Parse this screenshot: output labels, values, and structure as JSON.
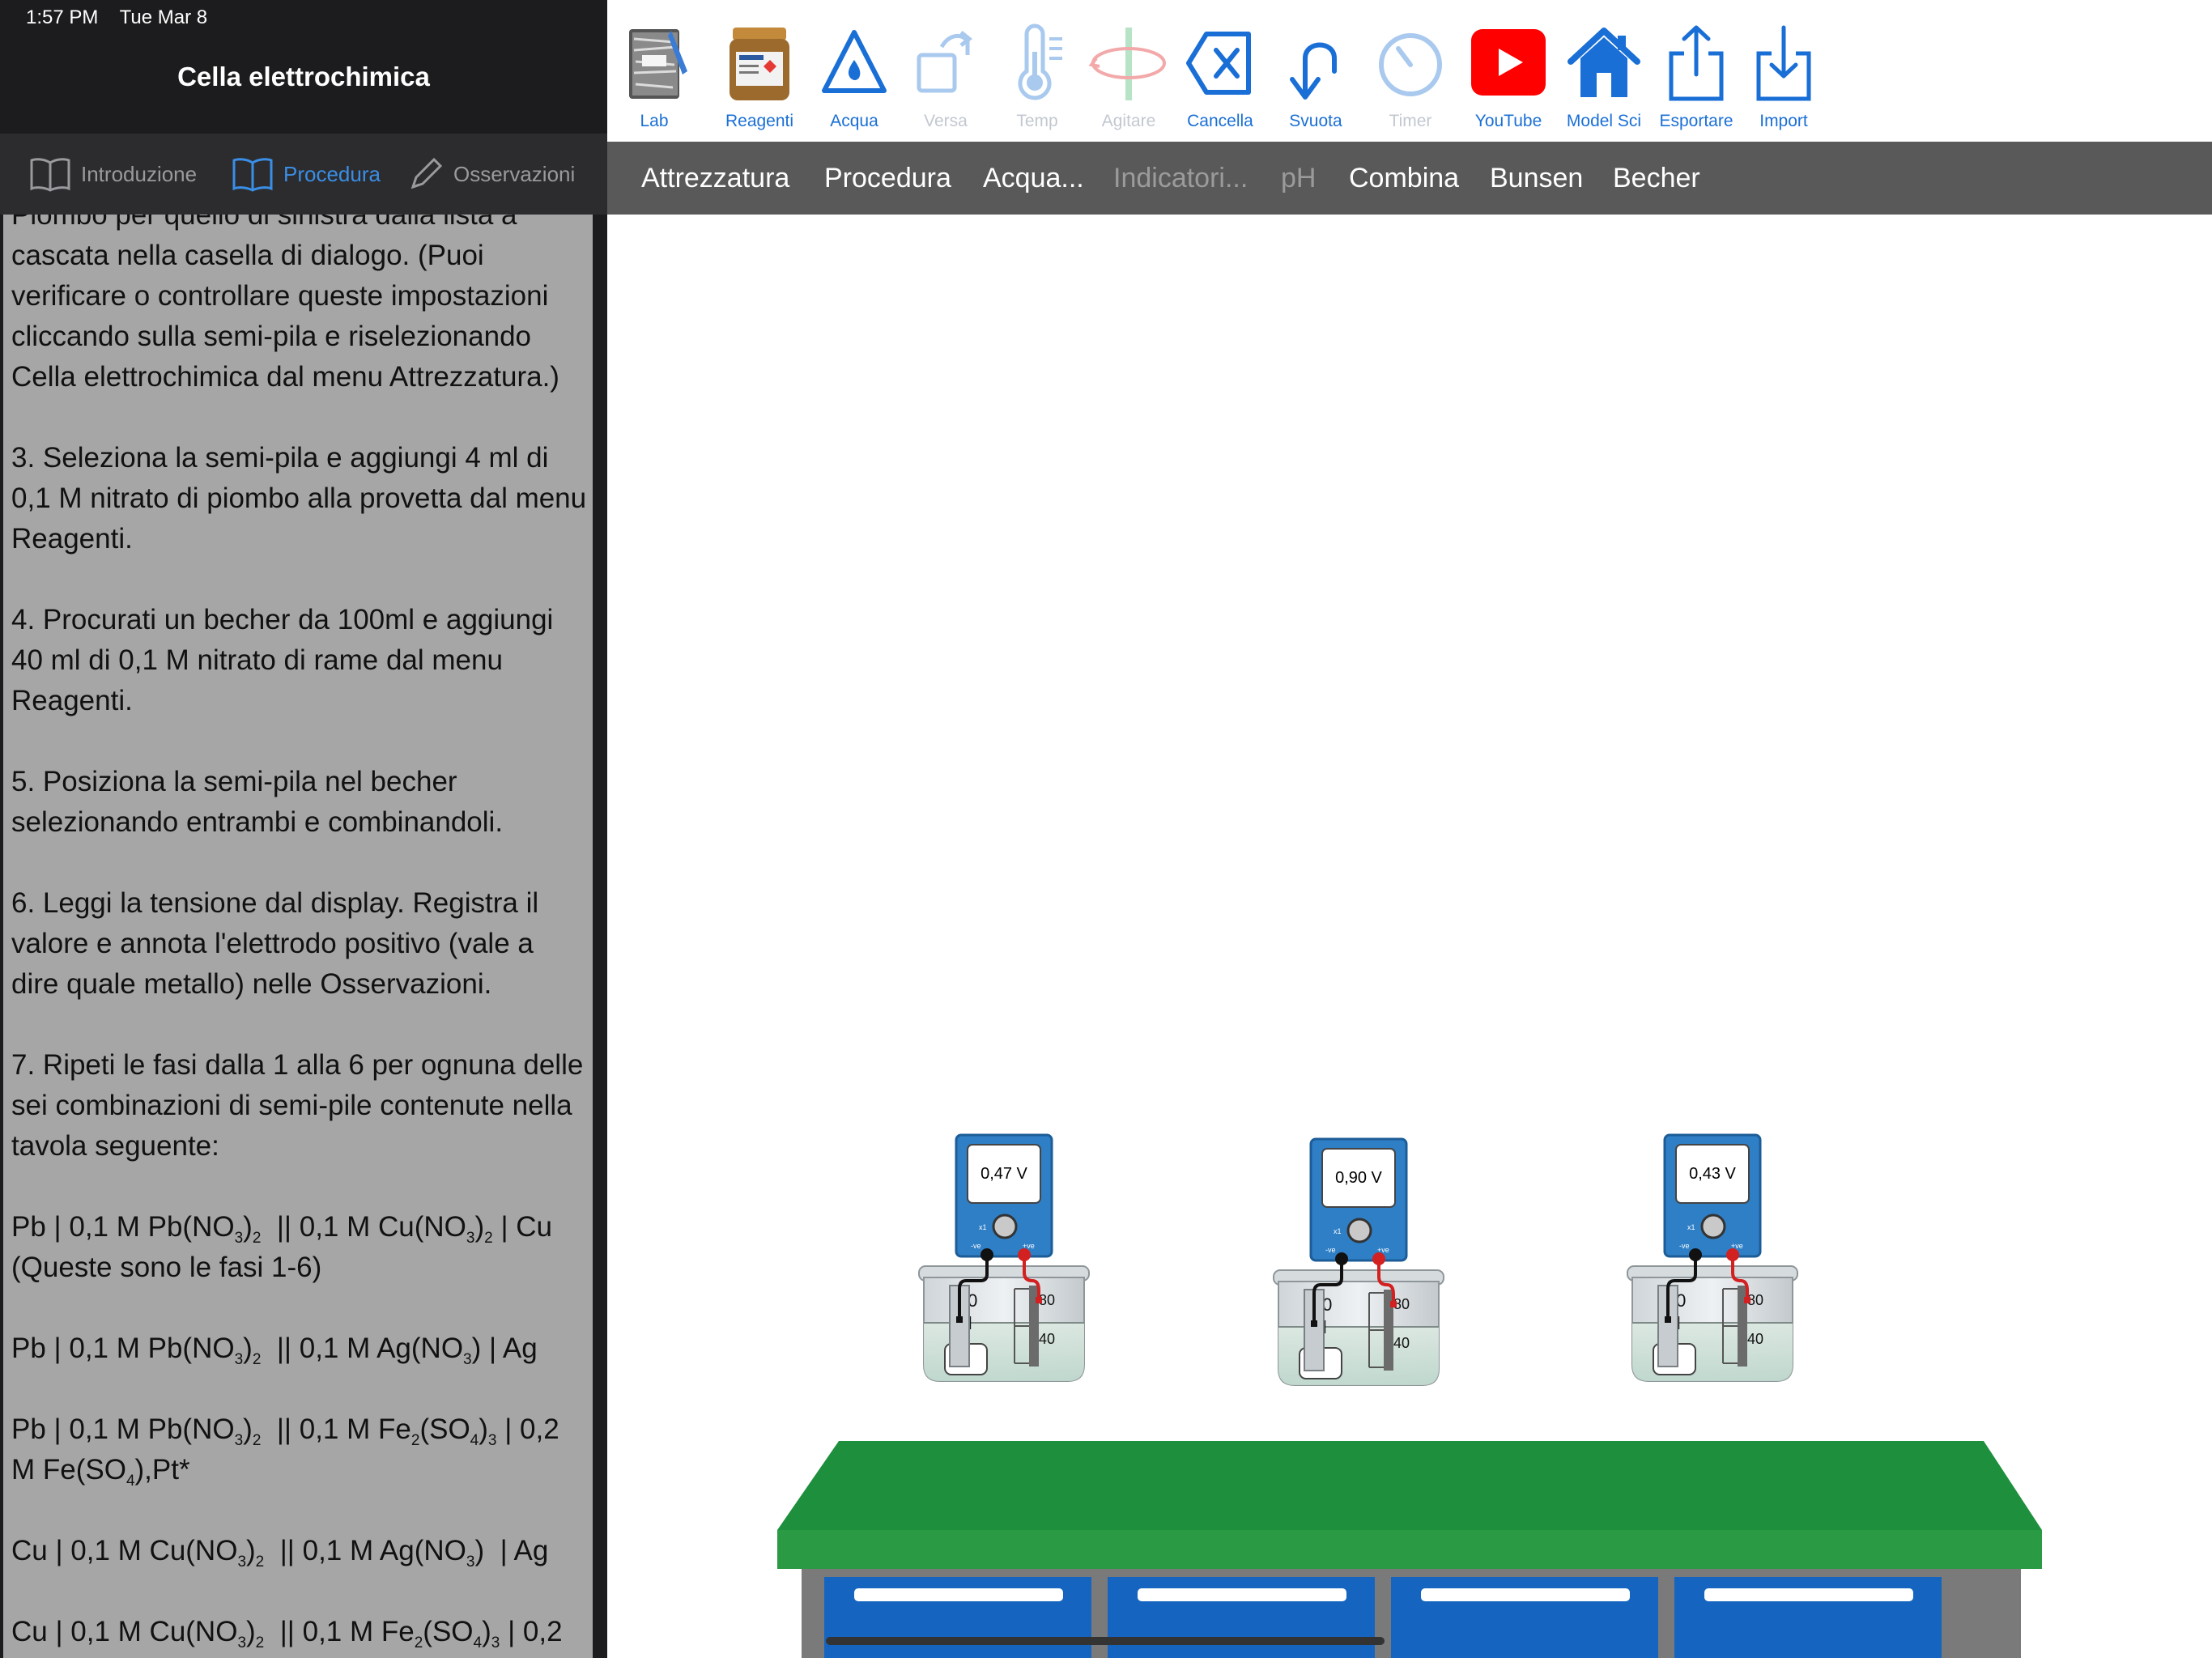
{
  "status_bar": {
    "time": "1:57 PM",
    "date": "Tue Mar 8"
  },
  "sidebar": {
    "title": "Cella elettrochimica",
    "tabs": [
      {
        "label": "Introduzione",
        "icon": "book-icon",
        "active": false
      },
      {
        "label": "Procedura",
        "icon": "book-icon",
        "active": true
      },
      {
        "label": "Osservazioni",
        "icon": "pencil-icon",
        "active": false
      }
    ],
    "content": {
      "partial_line": "Piombo per quello di sinistra dalla lista a",
      "para1": "cascata nella casella di dialogo. (Puoi verificare o controllare queste impostazioni cliccando sulla semi-pila e riselezionando Cella elettrochimica dal menu Attrezzatura.)",
      "step3": "3. Seleziona la semi-pila e aggiungi 4 ml di 0,1 M nitrato di piombo alla provetta dal menu Reagenti.",
      "step4": "4. Procurati un becher da 100ml e aggiungi 40 ml di 0,1 M nitrato di rame dal menu Reagenti.",
      "step5": "5. Posiziona la semi-pila nel becher selezionando entrambi e combinandoli.",
      "step6": "6. Leggi la tensione dal display. Registra il valore e annota l'elettrodo positivo (vale a dire quale metallo) nelle Osservazioni.",
      "step7": "7. Ripeti le fasi dalla 1 alla 6 per ognuna delle sei combinazioni di semi-pile contenute nella tavola seguente:",
      "note1": "(Queste sono le fasi 1-6)"
    }
  },
  "toolbar": {
    "tools": [
      {
        "label": "Lab",
        "icon": "lab-notebook-icon",
        "enabled": true
      },
      {
        "label": "Reagenti",
        "icon": "reagent-jar-icon",
        "enabled": true
      },
      {
        "label": "Acqua",
        "icon": "water-drop-icon",
        "enabled": true
      },
      {
        "label": "Versa",
        "icon": "pour-icon",
        "enabled": false
      },
      {
        "label": "Temp",
        "icon": "thermometer-icon",
        "enabled": false
      },
      {
        "label": "Agitare",
        "icon": "stir-icon",
        "enabled": false
      },
      {
        "label": "Cancella",
        "icon": "delete-icon",
        "enabled": true
      },
      {
        "label": "Svuota",
        "icon": "empty-icon",
        "enabled": true
      },
      {
        "label": "Timer",
        "icon": "timer-icon",
        "enabled": false
      },
      {
        "label": "YouTube",
        "icon": "youtube-icon",
        "enabled": true
      },
      {
        "label": "Model Sci",
        "icon": "home-icon",
        "enabled": true
      },
      {
        "label": "Esportare",
        "icon": "share-icon",
        "enabled": true
      },
      {
        "label": "Import",
        "icon": "import-icon",
        "enabled": true
      }
    ]
  },
  "menu": {
    "items": [
      {
        "label": "Attrezzatura",
        "enabled": true
      },
      {
        "label": "Procedura",
        "enabled": true
      },
      {
        "label": "Acqua...",
        "enabled": true
      },
      {
        "label": "Indicatori...",
        "enabled": false
      },
      {
        "label": "pH",
        "enabled": false
      },
      {
        "label": "Combina",
        "enabled": true
      },
      {
        "label": "Bunsen",
        "enabled": true
      },
      {
        "label": "Becher",
        "enabled": true
      }
    ]
  },
  "scene": {
    "cells": [
      {
        "voltage": "0,47 V"
      },
      {
        "voltage": "0,90 V"
      },
      {
        "voltage": "0,43 V"
      }
    ],
    "meter_labels": {
      "neg": "-ve",
      "pos": "+ve",
      "range": "x1"
    },
    "beaker_volume": "100",
    "beaker_unit": "ml",
    "scale_high": "80",
    "scale_low": "40"
  },
  "colors": {
    "accent": "#1a6fd6",
    "bench_top": "#1e8f3c",
    "meter_body": "#2f7fc6",
    "drawer": "#1565c0",
    "sidebar_bg": "#1c1c1e",
    "content_bg": "#a6a6a6"
  }
}
